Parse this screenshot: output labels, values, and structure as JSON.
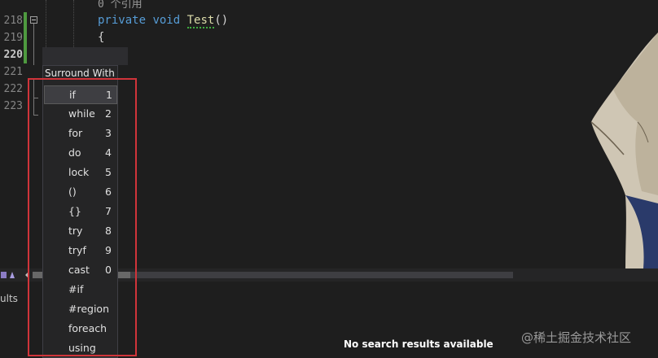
{
  "editor": {
    "line_numbers": [
      "218",
      "219",
      "220",
      "221",
      "222",
      "223"
    ],
    "codelens": "0 个引用",
    "line_218": {
      "kw1": "private",
      "kw2": "void",
      "fn": "Test",
      "tail": "()"
    },
    "line_219": "{"
  },
  "surround_menu": {
    "title": "Surround With",
    "items": [
      {
        "label": "if",
        "num": "1"
      },
      {
        "label": "while",
        "num": "2"
      },
      {
        "label": "for",
        "num": "3"
      },
      {
        "label": "do",
        "num": "4"
      },
      {
        "label": "lock",
        "num": "5"
      },
      {
        "label": "()",
        "num": "6"
      },
      {
        "label": "{}",
        "num": "7"
      },
      {
        "label": "try",
        "num": "8"
      },
      {
        "label": "tryf",
        "num": "9"
      },
      {
        "label": "cast",
        "num": "0"
      },
      {
        "label": "#if",
        "num": ""
      },
      {
        "label": "#region",
        "num": ""
      },
      {
        "label": "foreach",
        "num": ""
      },
      {
        "label": "using",
        "num": ""
      }
    ]
  },
  "panel": {
    "tab_label": "ults",
    "empty_message": "No search results available"
  },
  "watermark": "@稀土掘金技术社区",
  "colors": {
    "highlight": "#d0343a",
    "keyword": "#569cd6",
    "function": "#dcdcaa"
  },
  "icons": [
    "collapse-icon",
    "pen-icon",
    "scroll-left-icon"
  ]
}
